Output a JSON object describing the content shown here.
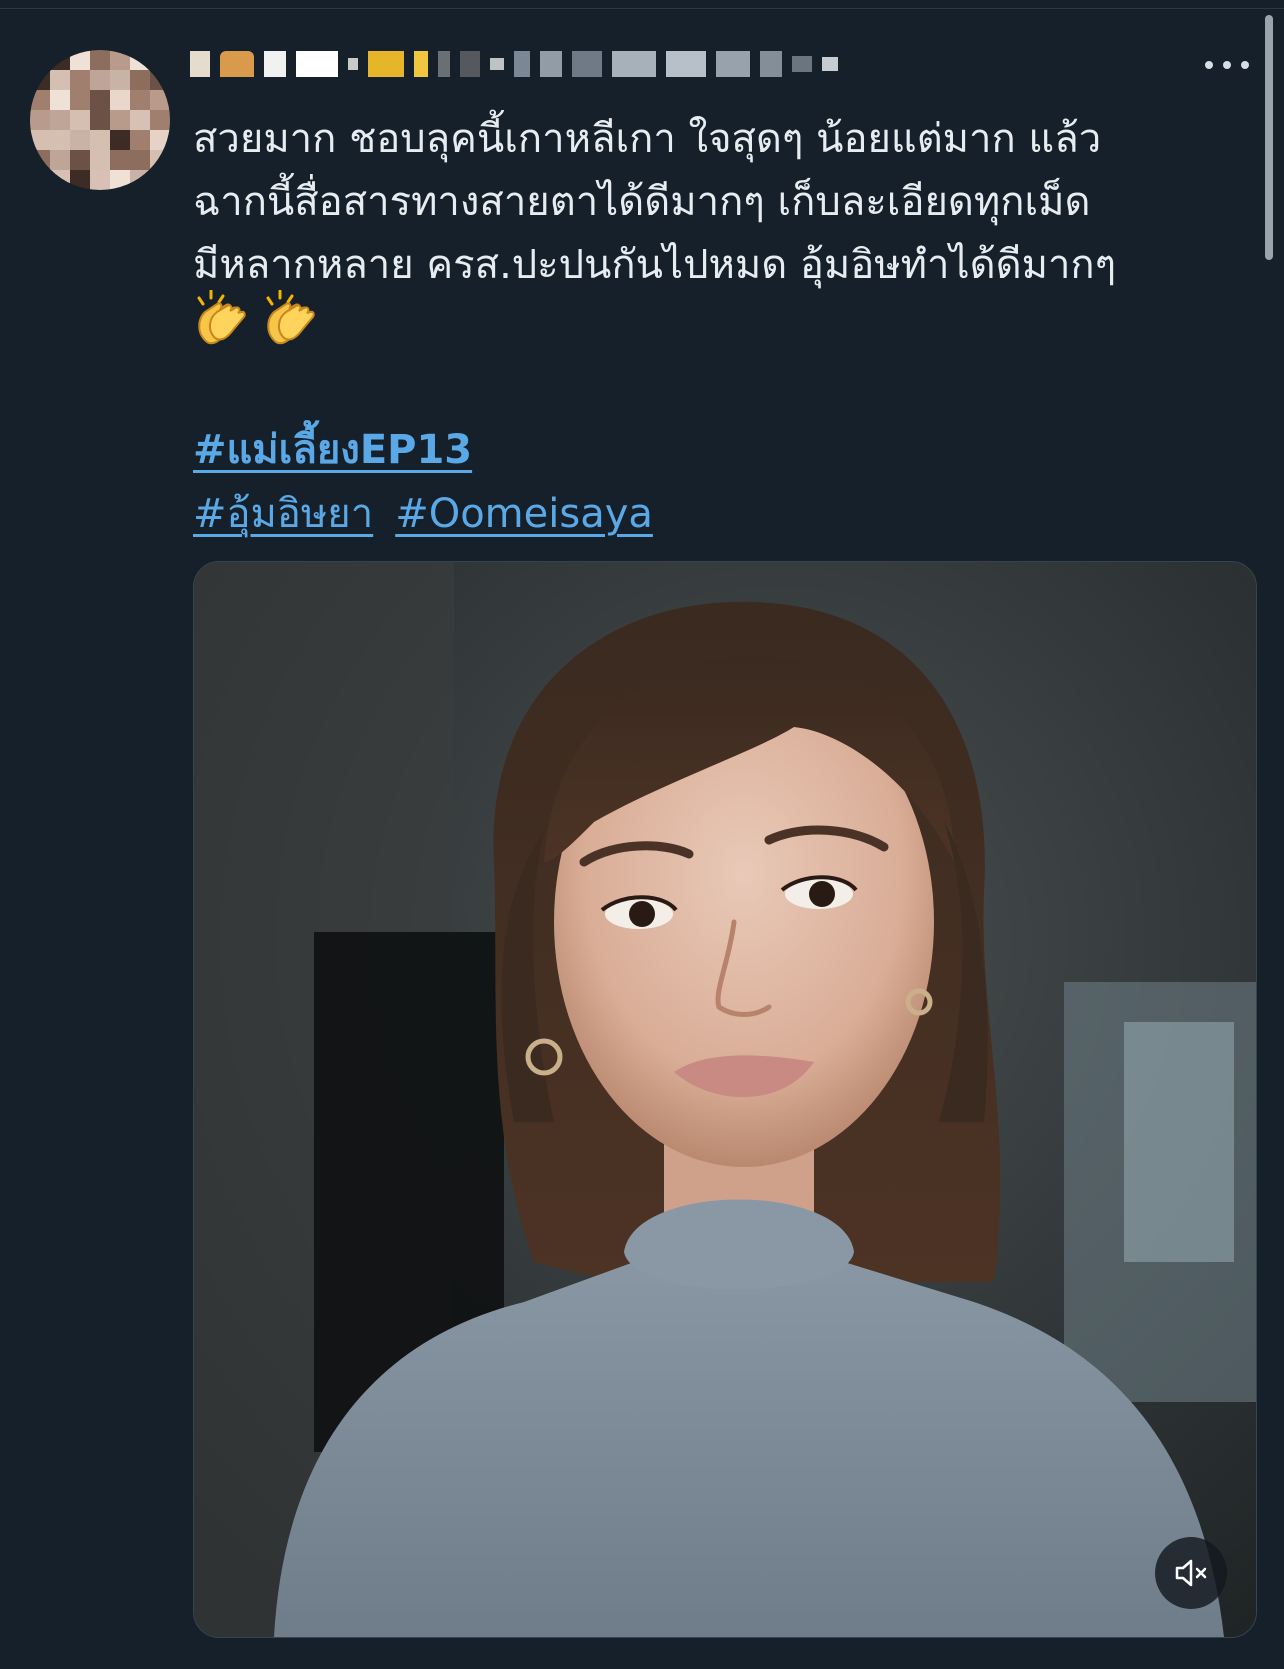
{
  "tweet": {
    "text": "สวยมาก ชอบลุคนี้เกาหลีเกา ใจสุดๆ  น้อยแต่มาก แล้ว\nฉากนี้สื่อสารทางสายตาได้ดีมากๆ  เก็บละเอียดทุกเม็ด\nมีหลากหลาย ครส.ปะปนกันไปหมด อุ้มอิษทำได้ดีมากๆ",
    "emoji": [
      "👏",
      "👏"
    ],
    "hashtags": {
      "first": "#แม่เลี้ยงEP13",
      "second": "#อุ้มอิษยา",
      "third": "#Oomeisaya"
    }
  },
  "icons": {
    "more": "more-horizontal-icon",
    "mute": "volume-muted-icon",
    "clap": "clapping-hands-icon"
  },
  "colors": {
    "background": "#15202b",
    "text": "#e7ecf0",
    "link": "#5aa9e6"
  }
}
